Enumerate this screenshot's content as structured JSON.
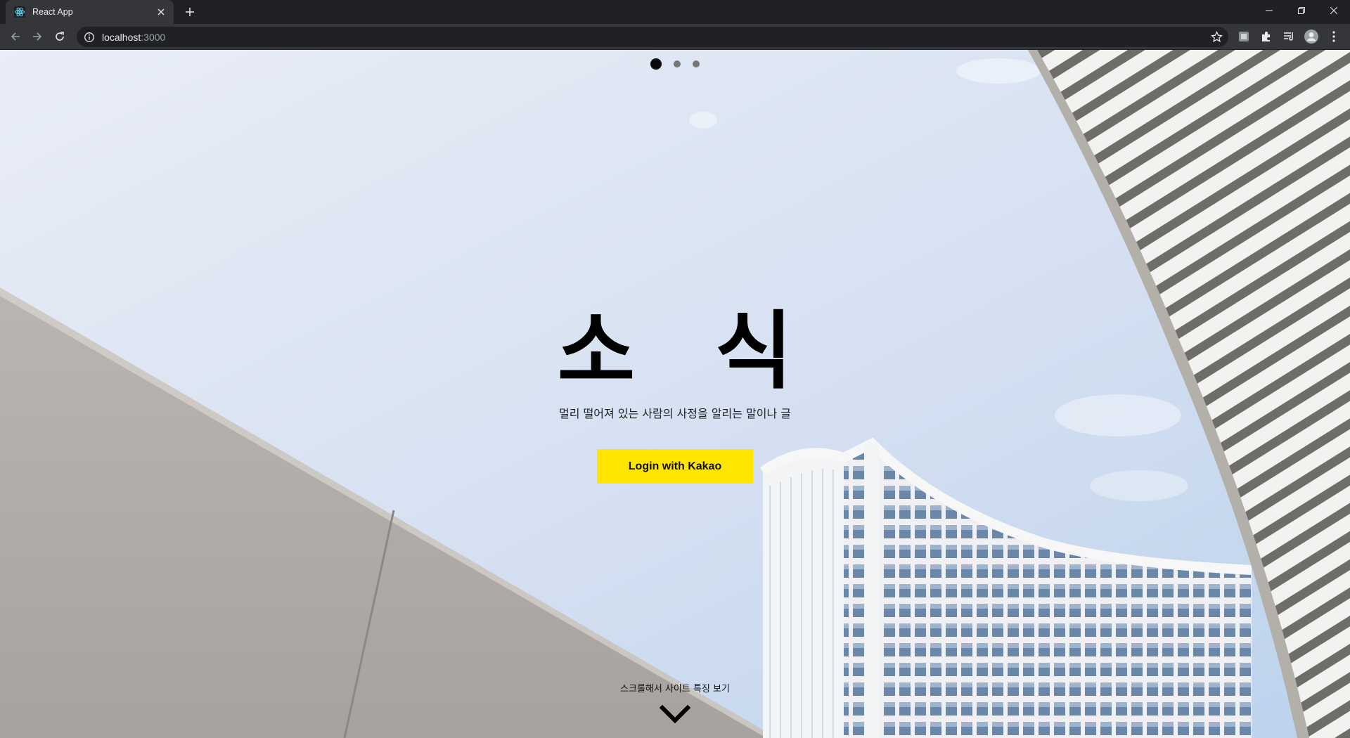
{
  "browser": {
    "tab_title": "React App",
    "new_tab_label": "+",
    "url_host": "localhost",
    "url_port": ":3000",
    "icons": [
      "react-favicon",
      "close-icon",
      "plus-icon",
      "minimize-icon",
      "restore-icon",
      "window-close-icon",
      "back-icon",
      "forward-icon",
      "reload-icon",
      "info-icon",
      "star-icon",
      "extension-icon",
      "puzzle-icon",
      "reading-list-icon",
      "profile-icon",
      "menu-icon"
    ]
  },
  "page": {
    "carousel": {
      "count": 3,
      "active_index": 0
    },
    "title": "소 식",
    "subtitle": "멀리 떨어져 있는 사람의 사정을 알리는 말이나 글",
    "login_button": "Login with Kakao",
    "scroll_hint": "스크롤해서 사이트 특징 보기",
    "colors": {
      "login_button": "#ffe500",
      "sky": "#d6e1f2",
      "text": "#000000"
    }
  }
}
